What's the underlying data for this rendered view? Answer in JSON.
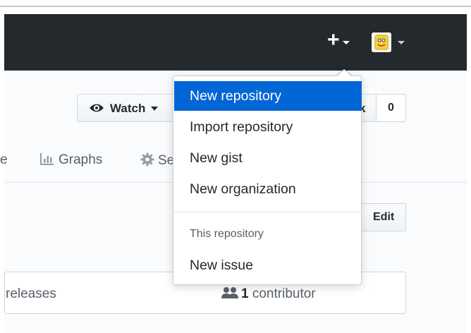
{
  "header": {
    "new_menu_icon": "plus-icon",
    "avatar_icon": "user-avatar"
  },
  "repo_actions": {
    "watch_label": "Watch",
    "fork_label_fragment": "k",
    "count": "0"
  },
  "tabs": [
    {
      "label": "e"
    },
    {
      "label": "Graphs",
      "icon": "graph-icon"
    },
    {
      "label": "Se",
      "icon": "gear-icon"
    }
  ],
  "edit_label": "Edit",
  "summary": {
    "releases": "releases",
    "contributors_count": "1",
    "contributors_label": "contributor"
  },
  "dropdown": {
    "items": [
      {
        "label": "New repository",
        "active": true
      },
      {
        "label": "Import repository"
      },
      {
        "label": "New gist"
      },
      {
        "label": "New organization"
      }
    ],
    "section_header": "This repository",
    "section_items": [
      {
        "label": "New issue"
      }
    ]
  },
  "colors": {
    "header_bg": "#24292e",
    "active_item_bg": "#0366d6"
  }
}
